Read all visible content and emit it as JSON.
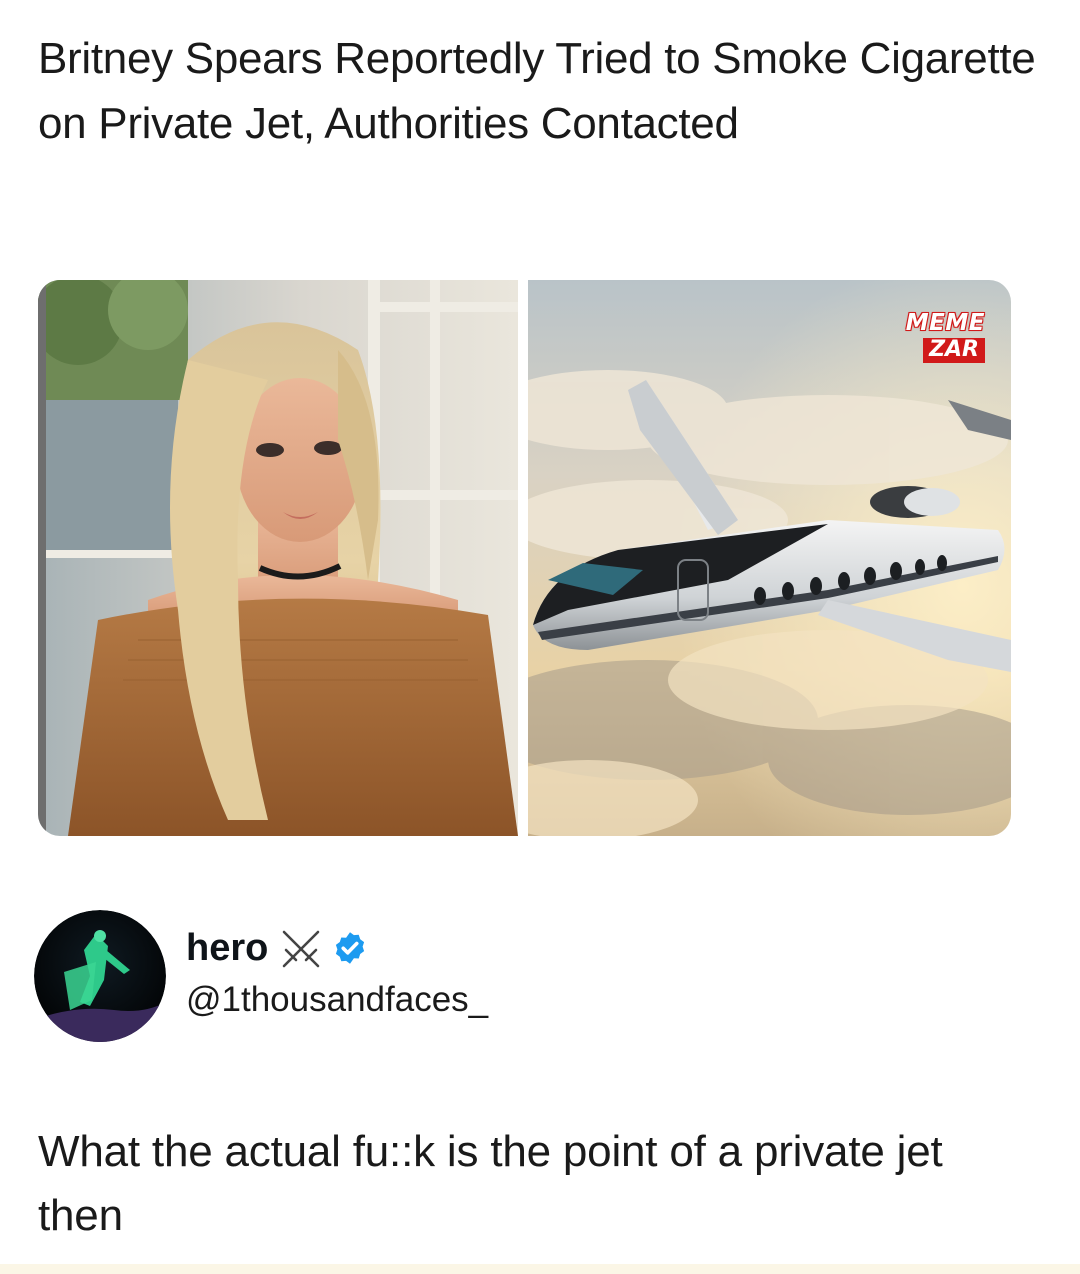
{
  "article": {
    "headline": "Britney Spears Reportedly Tried to Smoke Cigarette on Private Jet, Authorities Contacted"
  },
  "images": {
    "left": {
      "icon": "portrait-photo"
    },
    "right": {
      "icon": "private-jet-photo"
    }
  },
  "watermark": {
    "line1": "MEME",
    "line2": "ZAR",
    "color": "#d11a1a"
  },
  "tweet": {
    "display_name": "hero",
    "handle": "@1thousandfaces_",
    "verified": true,
    "verified_color": "#1d9bf0",
    "text": "What the actual fu::k is the point of a private jet then"
  }
}
